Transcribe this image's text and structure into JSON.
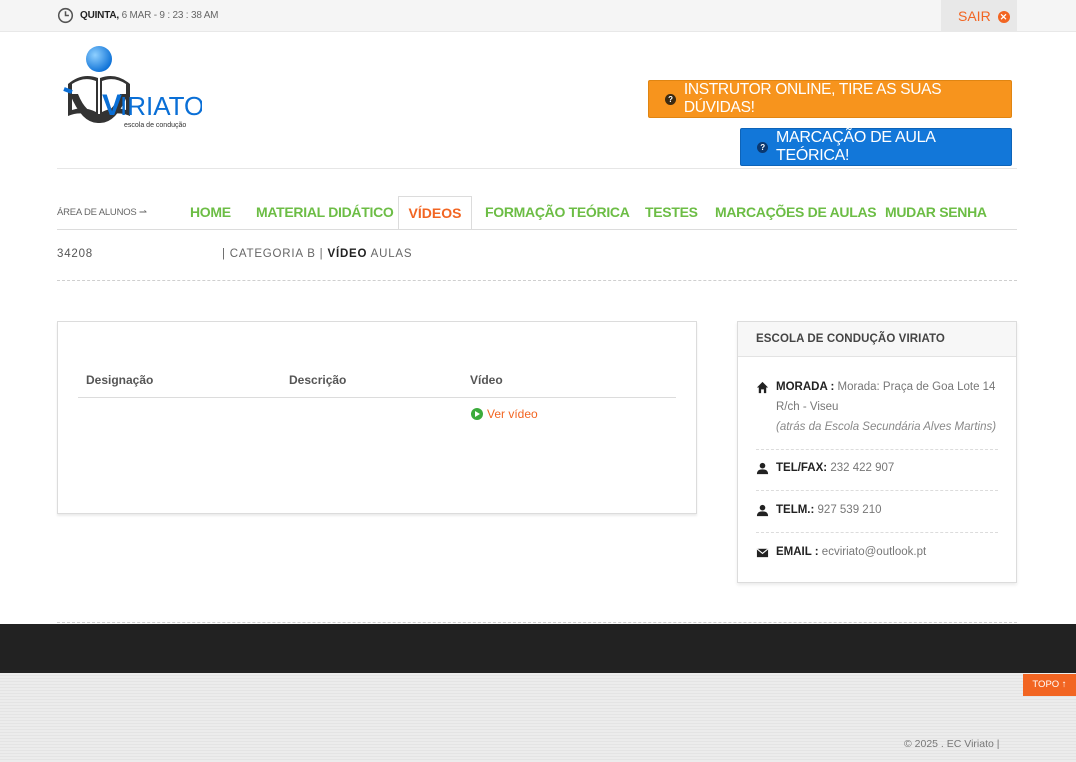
{
  "topbar": {
    "day": "QUINTA,",
    "date_time": "6 MAR - 9 : 23 : 38 AM",
    "logout_label": "SAIR",
    "logout_icon": "close-circle-icon"
  },
  "logo": {
    "brand": "VIRIATO",
    "tagline": "escola de condução"
  },
  "header": {
    "instructor_button": "INSTRUTOR ONLINE, TIRE AS SUAS DÚVIDAS!",
    "theory_button": "MARCAÇÃO DE AULA TEÓRICA!",
    "button_icon": "question-circle-icon",
    "colors": {
      "orange": "#f7941d",
      "blue": "#1277d9",
      "accent": "#f26522",
      "nav_green": "#6cbd45"
    }
  },
  "nav": {
    "area_label": "ÁREA DE ALUNOS ⇀",
    "items": [
      {
        "label": "HOME",
        "active": false
      },
      {
        "label": "MATERIAL DIDÁTICO",
        "active": false
      },
      {
        "label": "VÍDEOS",
        "active": true
      },
      {
        "label": "FORMAÇÃO TEÓRICA",
        "active": false
      },
      {
        "label": "TESTES",
        "active": false
      },
      {
        "label": "MARCAÇÕES DE AULAS",
        "active": false
      },
      {
        "label": "MUDAR SENHA",
        "active": false
      }
    ]
  },
  "breadcrumb": {
    "student_id": "34208",
    "category": "| CATEGORIA B |",
    "section_bold": "VÍDEO",
    "section_rest": "AULAS"
  },
  "videos_table": {
    "headers": [
      "Designação",
      "Descrição",
      "Vídeo"
    ],
    "rows": [
      {
        "designacao": "",
        "descricao": "",
        "video_link": "Ver vídeo",
        "icon": "play-circle-icon"
      }
    ]
  },
  "contact": {
    "title": "ESCOLA DE CONDUÇÃO VIRIATO",
    "address_label": "MORADA :",
    "address": "Morada: Praça de Goa Lote 14 R/ch - Viseu",
    "address_note": "(atrás da Escola Secundária Alves Martins)",
    "tel_label": "TEL/FAX:",
    "tel": "232 422 907",
    "mobile_label": "TELM.:",
    "mobile": "927 539 210",
    "email_label": "EMAIL :",
    "email": "ecviriato@outlook.pt"
  },
  "footer": {
    "top_label": "TOPO ↑",
    "copyright": "© 2025 . EC Viriato   |"
  }
}
